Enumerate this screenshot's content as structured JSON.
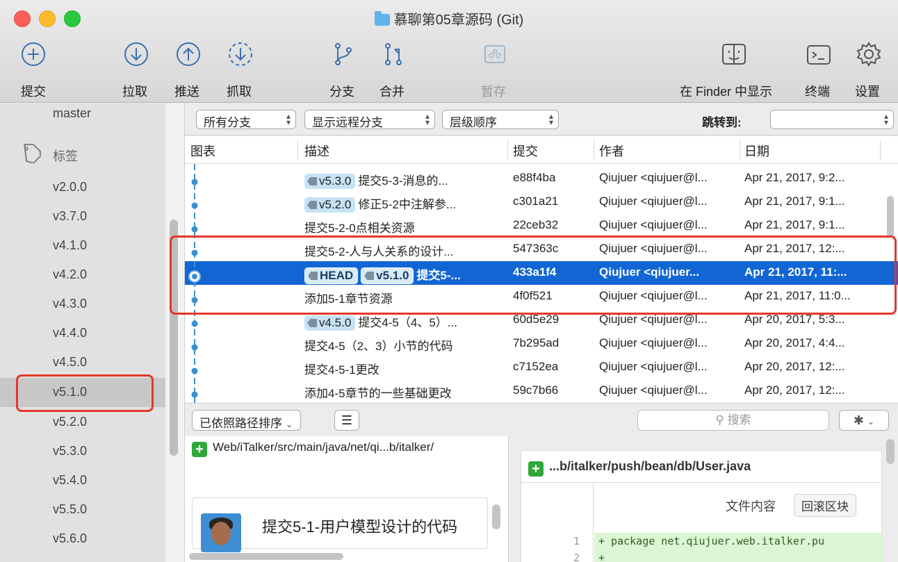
{
  "window": {
    "title": "慕聊第05章源码 (Git)"
  },
  "toolbar": {
    "commit": "提交",
    "pull": "拉取",
    "push": "推送",
    "fetch": "抓取",
    "branch": "分支",
    "merge": "合并",
    "stash": "暂存",
    "show_in_finder": "在 Finder 中显示",
    "terminal": "终端",
    "settings": "设置"
  },
  "sidebar": {
    "master": "master",
    "tags_heading": "标签",
    "tags": [
      "v2.0.0",
      "v3.7.0",
      "v4.1.0",
      "v4.2.0",
      "v4.3.0",
      "v4.4.0",
      "v4.5.0",
      "v5.1.0",
      "v5.2.0",
      "v5.3.0",
      "v5.4.0",
      "v5.5.0",
      "v5.6.0"
    ],
    "selected": "v5.1.0"
  },
  "filters": {
    "branches": "所有分支",
    "remote": "显示远程分支",
    "order": "层级顺序",
    "jump_to": "跳转到:",
    "jump_value": ""
  },
  "table": {
    "headers": {
      "graph": "图表",
      "desc": "描述",
      "commit": "提交",
      "author": "作者",
      "date": "日期"
    },
    "rows": [
      {
        "badges": [
          "v5.3.0"
        ],
        "desc": "提交5-3-消息的...",
        "commit": "e88f4ba",
        "author": "Qiujuer <qiujuer@l...",
        "date": "Apr 21, 2017, 9:2..."
      },
      {
        "badges": [
          "v5.2.0"
        ],
        "desc": "修正5-2中注解参...",
        "commit": "c301a21",
        "author": "Qiujuer <qiujuer@l...",
        "date": "Apr 21, 2017, 9:1..."
      },
      {
        "badges": [],
        "desc": "提交5-2-0点相关资源",
        "commit": "22ceb32",
        "author": "Qiujuer <qiujuer@l...",
        "date": "Apr 21, 2017, 9:1..."
      },
      {
        "badges": [],
        "desc": "提交5-2-人与人关系的设计...",
        "commit": "547363c",
        "author": "Qiujuer <qiujuer@l...",
        "date": "Apr 21, 2017, 12:..."
      },
      {
        "badges": [
          "HEAD",
          "v5.1.0"
        ],
        "desc": "提交5-...",
        "commit": "433a1f4",
        "author": "Qiujuer <qiujuer...",
        "date": "Apr 21, 2017, 11:...",
        "selected": true
      },
      {
        "badges": [],
        "desc": "添加5-1章节资源",
        "commit": "4f0f521",
        "author": "Qiujuer <qiujuer@l...",
        "date": "Apr 21, 2017, 11:0..."
      },
      {
        "badges": [
          "v4.5.0"
        ],
        "desc": "提交4-5（4、5）...",
        "commit": "60d5e29",
        "author": "Qiujuer <qiujuer@l...",
        "date": "Apr 20, 2017, 5:3..."
      },
      {
        "badges": [],
        "desc": "提交4-5（2、3）小节的代码",
        "commit": "7b295ad",
        "author": "Qiujuer <qiujuer@l...",
        "date": "Apr 20, 2017, 4:4..."
      },
      {
        "badges": [],
        "desc": "提交4-5-1更改",
        "commit": "c7152ea",
        "author": "Qiujuer <qiujuer@l...",
        "date": "Apr 20, 2017, 12:..."
      },
      {
        "badges": [],
        "desc": "添加4-5章节的一些基础更改",
        "commit": "59c7b66",
        "author": "Qiujuer <qiujuer@l...",
        "date": "Apr 20, 2017, 12:..."
      }
    ]
  },
  "bottom": {
    "sort": "已依照路径排序",
    "search_placeholder": "搜索",
    "file_path": "Web/iTalker/src/main/java/net/qi...b/italker/",
    "commit_title": "提交5-1-用户模型设计的代码"
  },
  "diff": {
    "file": "...b/italker/push/bean/db/User.java",
    "hunk_label": "文件内容",
    "revert": "回滚区块",
    "lines": [
      {
        "n": "1",
        "text": "+ package net.qiujuer.web.italker.pu"
      },
      {
        "n": "2",
        "text": "+"
      }
    ]
  },
  "colors": {
    "selection": "#1266d4",
    "highlight_box": "#e5362b",
    "added": "#2fa839",
    "graph": "#3a8fd1"
  }
}
